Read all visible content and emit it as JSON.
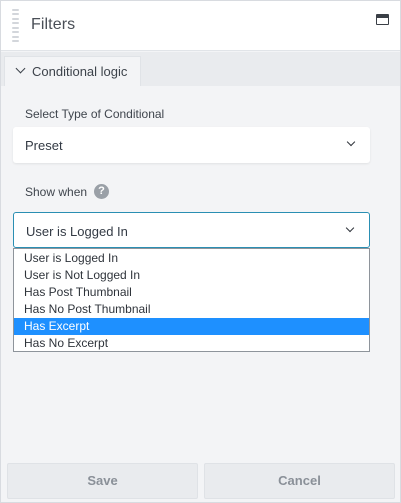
{
  "header": {
    "title": "Filters"
  },
  "tab": {
    "label": "Conditional logic"
  },
  "conditional_type": {
    "label": "Select Type of Conditional",
    "value": "Preset"
  },
  "show_when": {
    "label": "Show when",
    "help_glyph": "?",
    "value": "User is Logged In",
    "options": [
      "User is Logged In",
      "User is Not Logged In",
      "Has Post Thumbnail",
      "Has No Post Thumbnail",
      "Has Excerpt",
      "Has No Excerpt"
    ],
    "highlighted_option": "Has Excerpt"
  },
  "footer": {
    "save_label": "Save",
    "cancel_label": "Cancel"
  },
  "colors": {
    "focus_border": "#2a8fb3",
    "highlight": "#1e90ff",
    "panel_bg": "#f3f4f6"
  }
}
